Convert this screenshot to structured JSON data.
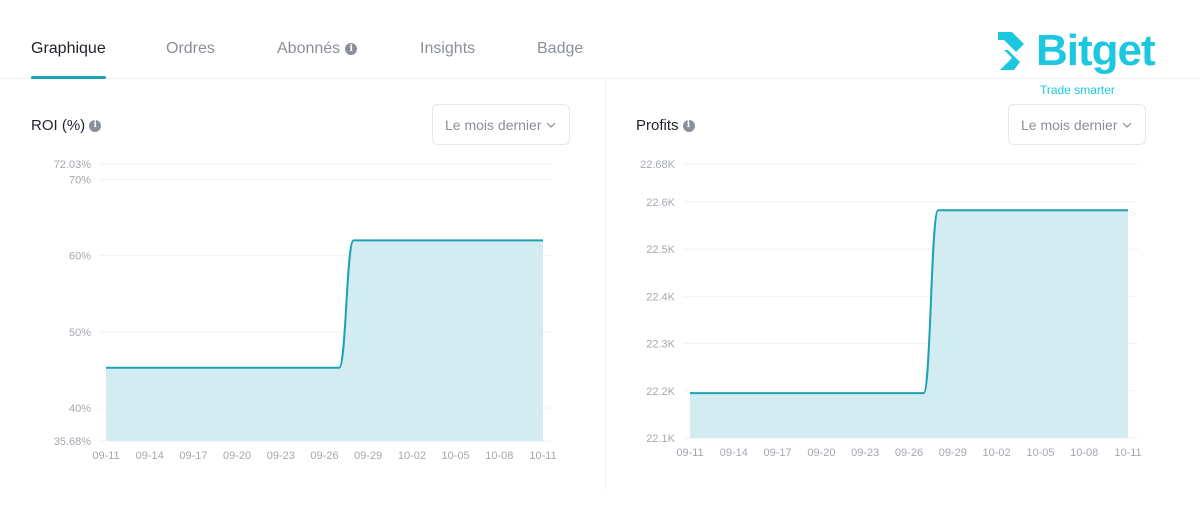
{
  "tabs": [
    {
      "label": "Graphique",
      "active": true
    },
    {
      "label": "Ordres",
      "active": false
    },
    {
      "label": "Abonnés",
      "active": false,
      "info": true
    },
    {
      "label": "Insights",
      "active": false
    },
    {
      "label": "Badge",
      "active": false
    }
  ],
  "logo": {
    "word": "Bitget",
    "tagline": "Trade smarter",
    "color": "#1cc8e0"
  },
  "roi_panel": {
    "title": "ROI (%)",
    "period": "Le mois dernier"
  },
  "profits_panel": {
    "title": "Profits",
    "period": "Le mois dernier"
  },
  "colors": {
    "line": "#1da2b4",
    "fill": "#d3ecf1",
    "grid": "#f1f2f4",
    "axis_text": "#a3a8b0"
  },
  "chart_data": [
    {
      "type": "area",
      "title": "ROI (%)",
      "x": [
        "09-11",
        "09-14",
        "09-17",
        "09-20",
        "09-23",
        "09-26",
        "09-29",
        "10-02",
        "10-05",
        "10-08",
        "10-11"
      ],
      "y_tick_labels": [
        "72.03%",
        "70%",
        "60%",
        "50%",
        "40%",
        "35.68%"
      ],
      "y_tick_values": [
        72.03,
        70,
        60,
        50,
        40,
        35.68
      ],
      "ylim": [
        35.68,
        72.03
      ],
      "unit": "%",
      "series": [
        {
          "points": [
            [
              "09-11",
              45.3
            ],
            [
              "09-27",
              45.3
            ],
            [
              "09-28",
              62.0
            ],
            [
              "10-11",
              62.0
            ]
          ]
        }
      ],
      "grid": true
    },
    {
      "type": "area",
      "title": "Profits",
      "x": [
        "09-11",
        "09-14",
        "09-17",
        "09-20",
        "09-23",
        "09-26",
        "09-29",
        "10-02",
        "10-05",
        "10-08",
        "10-11"
      ],
      "y_tick_labels": [
        "22.68K",
        "22.6K",
        "22.5K",
        "22.4K",
        "22.3K",
        "22.2K",
        "22.1K"
      ],
      "y_tick_values": [
        22680,
        22600,
        22500,
        22400,
        22300,
        22200,
        22100
      ],
      "ylim": [
        22100,
        22680
      ],
      "series": [
        {
          "points": [
            [
              "09-11",
              22195
            ],
            [
              "09-27",
              22195
            ],
            [
              "09-28",
              22582
            ],
            [
              "10-11",
              22582
            ]
          ]
        }
      ],
      "grid": true
    }
  ]
}
